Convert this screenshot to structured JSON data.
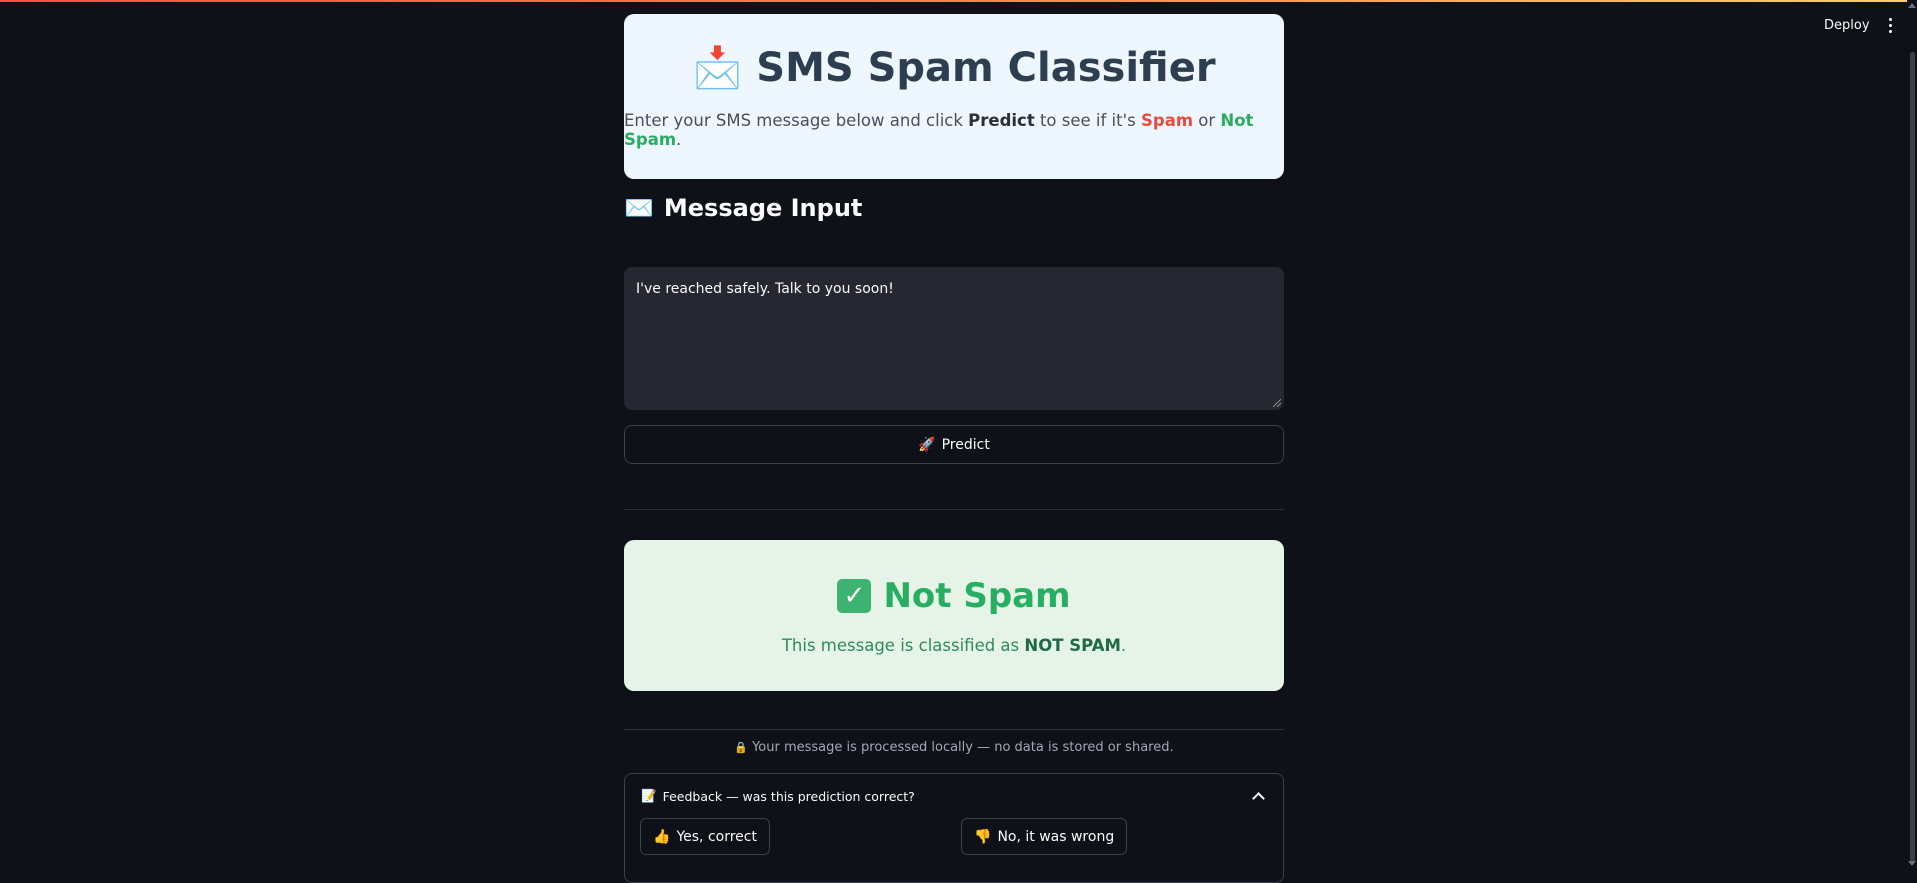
{
  "header": {
    "deploy_label": "Deploy"
  },
  "hero": {
    "icon": "📩",
    "title": "SMS Spam Classifier",
    "subtitle_pre": "Enter your SMS message below and click ",
    "subtitle_predict": "Predict",
    "subtitle_mid": " to see if it's ",
    "subtitle_spam": "Spam",
    "subtitle_or": " or ",
    "subtitle_not_spam": "Not Spam",
    "subtitle_end": "."
  },
  "input_section": {
    "icon": "✉️",
    "title": "Message Input",
    "message_value": "I've reached safely. Talk to you soon!"
  },
  "predict_button": {
    "icon": "🚀",
    "label": "Predict"
  },
  "result": {
    "icon": "✅",
    "title": "Not Spam",
    "text_pre": "This message is classified as ",
    "text_label": "NOT SPAM",
    "text_end": "."
  },
  "privacy": {
    "icon": "🔒",
    "text": "Your message is processed locally — no data is stored or shared."
  },
  "feedback": {
    "icon": "📝",
    "title": "Feedback — was this prediction correct?",
    "yes_icon": "👍",
    "yes_label": "Yes, correct",
    "no_icon": "👎",
    "no_label": "No, it was wrong"
  },
  "colors": {
    "background": "#0e1117",
    "spam_red": "#e74c3c",
    "not_spam_green": "#27ae60"
  }
}
